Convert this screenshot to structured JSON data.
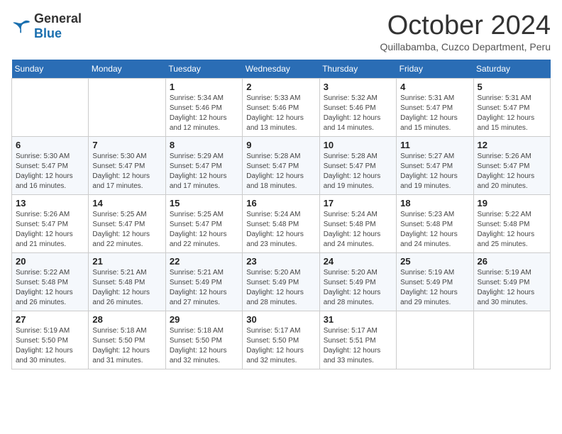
{
  "header": {
    "logo_general": "General",
    "logo_blue": "Blue",
    "month_title": "October 2024",
    "subtitle": "Quillabamba, Cuzco Department, Peru"
  },
  "days_of_week": [
    "Sunday",
    "Monday",
    "Tuesday",
    "Wednesday",
    "Thursday",
    "Friday",
    "Saturday"
  ],
  "weeks": [
    [
      {
        "day": "",
        "sunrise": "",
        "sunset": "",
        "daylight": ""
      },
      {
        "day": "",
        "sunrise": "",
        "sunset": "",
        "daylight": ""
      },
      {
        "day": "1",
        "sunrise": "Sunrise: 5:34 AM",
        "sunset": "Sunset: 5:46 PM",
        "daylight": "Daylight: 12 hours and 12 minutes."
      },
      {
        "day": "2",
        "sunrise": "Sunrise: 5:33 AM",
        "sunset": "Sunset: 5:46 PM",
        "daylight": "Daylight: 12 hours and 13 minutes."
      },
      {
        "day": "3",
        "sunrise": "Sunrise: 5:32 AM",
        "sunset": "Sunset: 5:46 PM",
        "daylight": "Daylight: 12 hours and 14 minutes."
      },
      {
        "day": "4",
        "sunrise": "Sunrise: 5:31 AM",
        "sunset": "Sunset: 5:47 PM",
        "daylight": "Daylight: 12 hours and 15 minutes."
      },
      {
        "day": "5",
        "sunrise": "Sunrise: 5:31 AM",
        "sunset": "Sunset: 5:47 PM",
        "daylight": "Daylight: 12 hours and 15 minutes."
      }
    ],
    [
      {
        "day": "6",
        "sunrise": "Sunrise: 5:30 AM",
        "sunset": "Sunset: 5:47 PM",
        "daylight": "Daylight: 12 hours and 16 minutes."
      },
      {
        "day": "7",
        "sunrise": "Sunrise: 5:30 AM",
        "sunset": "Sunset: 5:47 PM",
        "daylight": "Daylight: 12 hours and 17 minutes."
      },
      {
        "day": "8",
        "sunrise": "Sunrise: 5:29 AM",
        "sunset": "Sunset: 5:47 PM",
        "daylight": "Daylight: 12 hours and 17 minutes."
      },
      {
        "day": "9",
        "sunrise": "Sunrise: 5:28 AM",
        "sunset": "Sunset: 5:47 PM",
        "daylight": "Daylight: 12 hours and 18 minutes."
      },
      {
        "day": "10",
        "sunrise": "Sunrise: 5:28 AM",
        "sunset": "Sunset: 5:47 PM",
        "daylight": "Daylight: 12 hours and 19 minutes."
      },
      {
        "day": "11",
        "sunrise": "Sunrise: 5:27 AM",
        "sunset": "Sunset: 5:47 PM",
        "daylight": "Daylight: 12 hours and 19 minutes."
      },
      {
        "day": "12",
        "sunrise": "Sunrise: 5:26 AM",
        "sunset": "Sunset: 5:47 PM",
        "daylight": "Daylight: 12 hours and 20 minutes."
      }
    ],
    [
      {
        "day": "13",
        "sunrise": "Sunrise: 5:26 AM",
        "sunset": "Sunset: 5:47 PM",
        "daylight": "Daylight: 12 hours and 21 minutes."
      },
      {
        "day": "14",
        "sunrise": "Sunrise: 5:25 AM",
        "sunset": "Sunset: 5:47 PM",
        "daylight": "Daylight: 12 hours and 22 minutes."
      },
      {
        "day": "15",
        "sunrise": "Sunrise: 5:25 AM",
        "sunset": "Sunset: 5:47 PM",
        "daylight": "Daylight: 12 hours and 22 minutes."
      },
      {
        "day": "16",
        "sunrise": "Sunrise: 5:24 AM",
        "sunset": "Sunset: 5:48 PM",
        "daylight": "Daylight: 12 hours and 23 minutes."
      },
      {
        "day": "17",
        "sunrise": "Sunrise: 5:24 AM",
        "sunset": "Sunset: 5:48 PM",
        "daylight": "Daylight: 12 hours and 24 minutes."
      },
      {
        "day": "18",
        "sunrise": "Sunrise: 5:23 AM",
        "sunset": "Sunset: 5:48 PM",
        "daylight": "Daylight: 12 hours and 24 minutes."
      },
      {
        "day": "19",
        "sunrise": "Sunrise: 5:22 AM",
        "sunset": "Sunset: 5:48 PM",
        "daylight": "Daylight: 12 hours and 25 minutes."
      }
    ],
    [
      {
        "day": "20",
        "sunrise": "Sunrise: 5:22 AM",
        "sunset": "Sunset: 5:48 PM",
        "daylight": "Daylight: 12 hours and 26 minutes."
      },
      {
        "day": "21",
        "sunrise": "Sunrise: 5:21 AM",
        "sunset": "Sunset: 5:48 PM",
        "daylight": "Daylight: 12 hours and 26 minutes."
      },
      {
        "day": "22",
        "sunrise": "Sunrise: 5:21 AM",
        "sunset": "Sunset: 5:49 PM",
        "daylight": "Daylight: 12 hours and 27 minutes."
      },
      {
        "day": "23",
        "sunrise": "Sunrise: 5:20 AM",
        "sunset": "Sunset: 5:49 PM",
        "daylight": "Daylight: 12 hours and 28 minutes."
      },
      {
        "day": "24",
        "sunrise": "Sunrise: 5:20 AM",
        "sunset": "Sunset: 5:49 PM",
        "daylight": "Daylight: 12 hours and 28 minutes."
      },
      {
        "day": "25",
        "sunrise": "Sunrise: 5:19 AM",
        "sunset": "Sunset: 5:49 PM",
        "daylight": "Daylight: 12 hours and 29 minutes."
      },
      {
        "day": "26",
        "sunrise": "Sunrise: 5:19 AM",
        "sunset": "Sunset: 5:49 PM",
        "daylight": "Daylight: 12 hours and 30 minutes."
      }
    ],
    [
      {
        "day": "27",
        "sunrise": "Sunrise: 5:19 AM",
        "sunset": "Sunset: 5:50 PM",
        "daylight": "Daylight: 12 hours and 30 minutes."
      },
      {
        "day": "28",
        "sunrise": "Sunrise: 5:18 AM",
        "sunset": "Sunset: 5:50 PM",
        "daylight": "Daylight: 12 hours and 31 minutes."
      },
      {
        "day": "29",
        "sunrise": "Sunrise: 5:18 AM",
        "sunset": "Sunset: 5:50 PM",
        "daylight": "Daylight: 12 hours and 32 minutes."
      },
      {
        "day": "30",
        "sunrise": "Sunrise: 5:17 AM",
        "sunset": "Sunset: 5:50 PM",
        "daylight": "Daylight: 12 hours and 32 minutes."
      },
      {
        "day": "31",
        "sunrise": "Sunrise: 5:17 AM",
        "sunset": "Sunset: 5:51 PM",
        "daylight": "Daylight: 12 hours and 33 minutes."
      },
      {
        "day": "",
        "sunrise": "",
        "sunset": "",
        "daylight": ""
      },
      {
        "day": "",
        "sunrise": "",
        "sunset": "",
        "daylight": ""
      }
    ]
  ]
}
